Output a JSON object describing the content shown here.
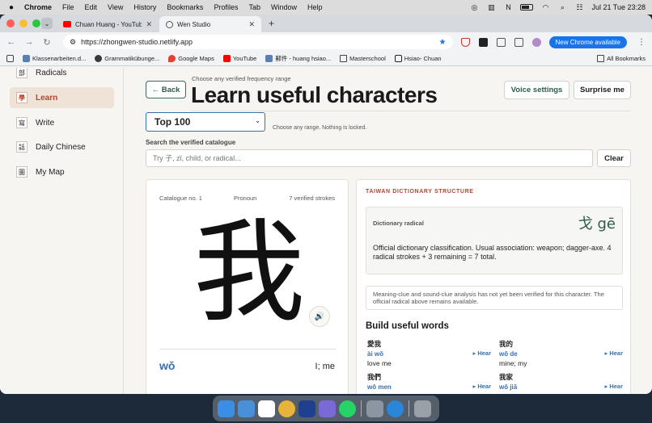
{
  "menubar": {
    "app": "Chrome",
    "items": [
      "File",
      "Edit",
      "View",
      "History",
      "Bookmarks",
      "Profiles",
      "Tab",
      "Window",
      "Help"
    ],
    "datetime": "Jul 21 Tue  23:28"
  },
  "tabs": [
    {
      "title": "Chuan Huang - YouTube"
    },
    {
      "title": "Wen Studio"
    }
  ],
  "address": {
    "url": "https://zhongwen-studio.netlify.app",
    "chrome_available": "New Chrome available"
  },
  "bookmarks": [
    {
      "label": "Klassenarbeiten.d..."
    },
    {
      "label": "Grammatikübunge..."
    },
    {
      "label": "Google Maps"
    },
    {
      "label": "YouTube"
    },
    {
      "label": "郵件 - huang hsiao..."
    },
    {
      "label": "Masterschool"
    },
    {
      "label": "Hsiao- Chuan"
    }
  ],
  "all_bookmarks": "All Bookmarks",
  "sidebar": {
    "items": [
      {
        "glyph": "部",
        "label": "Radicals"
      },
      {
        "glyph": "學",
        "label": "Learn"
      },
      {
        "glyph": "寫",
        "label": "Write"
      },
      {
        "glyph": "話",
        "label": "Daily Chinese"
      },
      {
        "glyph": "圖",
        "label": "My Map"
      }
    ]
  },
  "header": {
    "back": "← Back",
    "hint": "Choose any verified frequency range",
    "title": "Learn useful characters",
    "voice_settings": "Voice settings",
    "surprise": "Surprise me"
  },
  "range": {
    "selected": "Top 100",
    "hint": "Choose any range. Nothing is locked."
  },
  "search": {
    "label": "Search the verified catalogue",
    "placeholder": "Try 子, zǐ, child, or radical...",
    "clear": "Clear"
  },
  "character": {
    "catalogue": "Catalogue no. 1",
    "category": "Pronoun",
    "strokes": "7 verified strokes",
    "glyph": "我",
    "pinyin": "wǒ",
    "meaning": "I; me"
  },
  "dictionary": {
    "heading": "TAIWAN DICTIONARY STRUCTURE",
    "radical_label": "Dictionary radical",
    "radical": "戈 gē",
    "description": "Official dictionary classification. Usual association: weapon; dagger-axe. 4 radical strokes + 3 remaining = 7 total.",
    "note": "Meaning-clue and sound-clue analysis has not yet been verified for this character. The official radical above remains available."
  },
  "words": {
    "heading": "Build useful words",
    "hear_label": "▸ Hear",
    "items": [
      {
        "hanzi": "愛我",
        "pinyin": "ài wǒ",
        "gloss": "love me"
      },
      {
        "hanzi": "我的",
        "pinyin": "wǒ de",
        "gloss": "mine; my"
      },
      {
        "hanzi": "我們",
        "pinyin": "wǒ men",
        "gloss": ""
      },
      {
        "hanzi": "我家",
        "pinyin": "wǒ jiā",
        "gloss": ""
      }
    ]
  },
  "colors": {
    "accent_green": "#2e5c4a",
    "accent_blue": "#3a6fb0",
    "accent_red": "#b44430",
    "page_bg": "#f7f5f2"
  }
}
